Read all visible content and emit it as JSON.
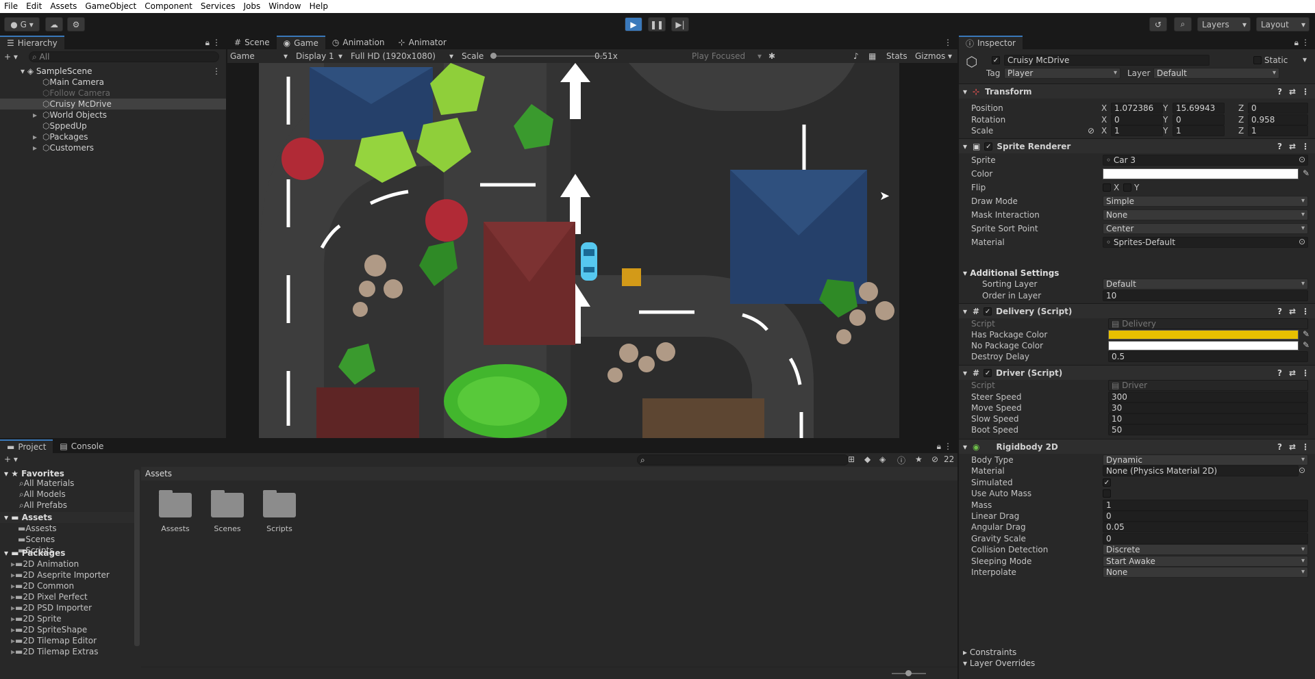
{
  "menu": [
    "File",
    "Edit",
    "Assets",
    "GameObject",
    "Component",
    "Services",
    "Jobs",
    "Window",
    "Help"
  ],
  "toolbar": {
    "account": "G",
    "layers": "Layers",
    "layout": "Layout"
  },
  "hierarchy": {
    "tab": "Hierarchy",
    "search_placeholder": "All",
    "scene": "SampleScene",
    "items": [
      {
        "label": "Main Camera",
        "dim": false,
        "indent": 1
      },
      {
        "label": "Follow Camera",
        "dim": true,
        "indent": 1
      },
      {
        "label": "Cruisy McDrive",
        "dim": false,
        "indent": 1,
        "selected": true
      },
      {
        "label": "World Objects",
        "dim": false,
        "indent": 1,
        "arrow": true
      },
      {
        "label": "SppedUp",
        "dim": false,
        "indent": 1
      },
      {
        "label": "Packages",
        "dim": false,
        "indent": 1,
        "arrow": true
      },
      {
        "label": "Customers",
        "dim": false,
        "indent": 1,
        "arrow": true
      }
    ]
  },
  "game": {
    "tabs": [
      "Scene",
      "Game",
      "Animation",
      "Animator"
    ],
    "mode": "Game",
    "display": "Display 1",
    "resolution": "Full HD (1920x1080)",
    "scale_label": "Scale",
    "scale_value": "0.51x",
    "play_focused": "Play Focused",
    "stats": "Stats",
    "gizmos": "Gizmos"
  },
  "project": {
    "tabs": [
      "Project",
      "Console"
    ],
    "favorites_label": "Favorites",
    "favorites": [
      "All Materials",
      "All Models",
      "All Prefabs"
    ],
    "assets_label": "Assets",
    "asset_folders": [
      "Assests",
      "Scenes",
      "Scripts"
    ],
    "packages_label": "Packages",
    "packages": [
      "2D Animation",
      "2D Aseprite Importer",
      "2D Common",
      "2D Pixel Perfect",
      "2D PSD Importer",
      "2D Sprite",
      "2D SpriteShape",
      "2D Tilemap Editor",
      "2D Tilemap Extras"
    ],
    "breadcrumb": "Assets",
    "grid_items": [
      "Assests",
      "Scenes",
      "Scripts"
    ],
    "hidden_count": "22"
  },
  "inspector": {
    "tab": "Inspector",
    "object_name": "Cruisy McDrive",
    "static_label": "Static",
    "tag_label": "Tag",
    "tag": "Player",
    "layer_label": "Layer",
    "layer": "Default",
    "transform": {
      "title": "Transform",
      "position_label": "Position",
      "position": {
        "x": "1.072386",
        "y": "15.69943",
        "z": "0"
      },
      "rotation_label": "Rotation",
      "rotation": {
        "x": "0",
        "y": "0",
        "z": "0.958"
      },
      "scale_label": "Scale",
      "scale": {
        "x": "1",
        "y": "1",
        "z": "1"
      }
    },
    "sprite_renderer": {
      "title": "Sprite Renderer",
      "rows": [
        {
          "label": "Sprite",
          "value": "Car 3"
        },
        {
          "label": "Color",
          "value": ""
        },
        {
          "label": "Flip",
          "value": ""
        },
        {
          "label": "Draw Mode",
          "value": "Simple"
        },
        {
          "label": "Mask Interaction",
          "value": "None"
        },
        {
          "label": "Sprite Sort Point",
          "value": "Center"
        },
        {
          "label": "Material",
          "value": "Sprites-Default"
        }
      ],
      "additional_settings": "Additional Settings",
      "sorting_layer_label": "Sorting Layer",
      "sorting_layer": "Default",
      "order_label": "Order in Layer",
      "order": "10"
    },
    "delivery": {
      "title": "Delivery (Script)",
      "script_label": "Script",
      "script": "Delivery",
      "has_label": "Has Package Color",
      "has_color": "#e8c000",
      "no_label": "No Package Color",
      "no_color": "#ffffff",
      "destroy_label": "Destroy Delay",
      "destroy": "0.5"
    },
    "driver": {
      "title": "Driver (Script)",
      "script_label": "Script",
      "script": "Driver",
      "rows": [
        {
          "label": "Steer Speed",
          "value": "300"
        },
        {
          "label": "Move Speed",
          "value": "30"
        },
        {
          "label": "Slow Speed",
          "value": "10"
        },
        {
          "label": "Boot Speed",
          "value": "50"
        }
      ]
    },
    "rigidbody": {
      "title": "Rigidbody 2D",
      "rows": [
        {
          "label": "Body Type",
          "value": "Dynamic",
          "kind": "drop"
        },
        {
          "label": "Material",
          "value": "None (Physics Material 2D)",
          "kind": "field"
        },
        {
          "label": "Simulated",
          "value": "✓",
          "kind": "check"
        },
        {
          "label": "Use Auto Mass",
          "value": "",
          "kind": "check"
        },
        {
          "label": "Mass",
          "value": "1",
          "kind": "field"
        },
        {
          "label": "Linear Drag",
          "value": "0",
          "kind": "field"
        },
        {
          "label": "Angular Drag",
          "value": "0.05",
          "kind": "field"
        },
        {
          "label": "Gravity Scale",
          "value": "0",
          "kind": "field"
        },
        {
          "label": "Collision Detection",
          "value": "Discrete",
          "kind": "drop"
        },
        {
          "label": "Sleeping Mode",
          "value": "Start Awake",
          "kind": "drop"
        },
        {
          "label": "Interpolate",
          "value": "None",
          "kind": "drop"
        }
      ],
      "constraints": "Constraints",
      "layer_overrides": "Layer Overrides"
    }
  }
}
